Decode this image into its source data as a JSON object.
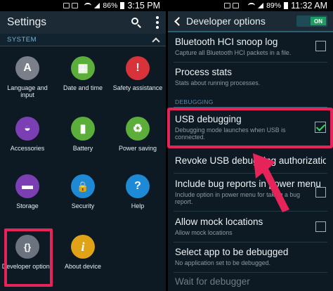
{
  "left": {
    "status": {
      "battery": "86%",
      "time": "3:15 PM"
    },
    "header": {
      "title": "Settings"
    },
    "section": {
      "label": "SYSTEM"
    },
    "tiles": [
      {
        "label": "Language and input",
        "color": "#7a7f8a",
        "glyph": "A",
        "icon": "language-icon"
      },
      {
        "label": "Date and time",
        "color": "#5cae3a",
        "glyph": "▦",
        "icon": "calendar-clock-icon"
      },
      {
        "label": "Safety assistance",
        "color": "#d8323a",
        "glyph": "!",
        "icon": "safety-alert-icon"
      },
      {
        "label": "Accessories",
        "color": "#7b3fb3",
        "glyph": "◒",
        "icon": "headset-icon"
      },
      {
        "label": "Battery",
        "color": "#5cae3a",
        "glyph": "▮",
        "icon": "battery-icon"
      },
      {
        "label": "Power saving",
        "color": "#5cae3a",
        "glyph": "♻",
        "icon": "power-saving-icon"
      },
      {
        "label": "Storage",
        "color": "#7b3fb3",
        "glyph": "▬",
        "icon": "sd-card-icon"
      },
      {
        "label": "Security",
        "color": "#1e8ad6",
        "glyph": "🔒",
        "icon": "lock-icon"
      },
      {
        "label": "Help",
        "color": "#1e8ad6",
        "glyph": "?",
        "icon": "help-icon"
      },
      {
        "label": "Developer options",
        "color": "#6c7380",
        "glyph": "{}",
        "icon": "braces-icon"
      },
      {
        "label": "About device",
        "color": "#e0a318",
        "glyph": "i",
        "icon": "info-icon"
      }
    ]
  },
  "right": {
    "status": {
      "battery": "89%",
      "time": "11:32 AM"
    },
    "header": {
      "title": "Developer options",
      "toggle": "ON"
    },
    "items": [
      {
        "title": "Bluetooth HCI snoop log",
        "sub": "Capture all Bluetooth HCI packets in a file."
      },
      {
        "title": "Process stats",
        "sub": "Stats about running processes."
      },
      {
        "title": "USB debugging",
        "sub": "Debugging mode launches when USB is connected.",
        "checked": true
      },
      {
        "title": "Revoke USB debugging authorizations",
        "sub": ""
      },
      {
        "title": "Include bug reports in power menu",
        "sub": "Include option in power menu for taking a bug report."
      },
      {
        "title": "Allow mock locations",
        "sub": "Allow mock locations"
      },
      {
        "title": "Select app to be debugged",
        "sub": "No application set to be debugged."
      },
      {
        "title": "Wait for debugger",
        "sub": ""
      }
    ],
    "section": {
      "label": "DEBUGGING"
    }
  },
  "colors": {
    "highlight": "#e6245a",
    "check": "#3fd36a",
    "accent": "#1f9c5f"
  }
}
